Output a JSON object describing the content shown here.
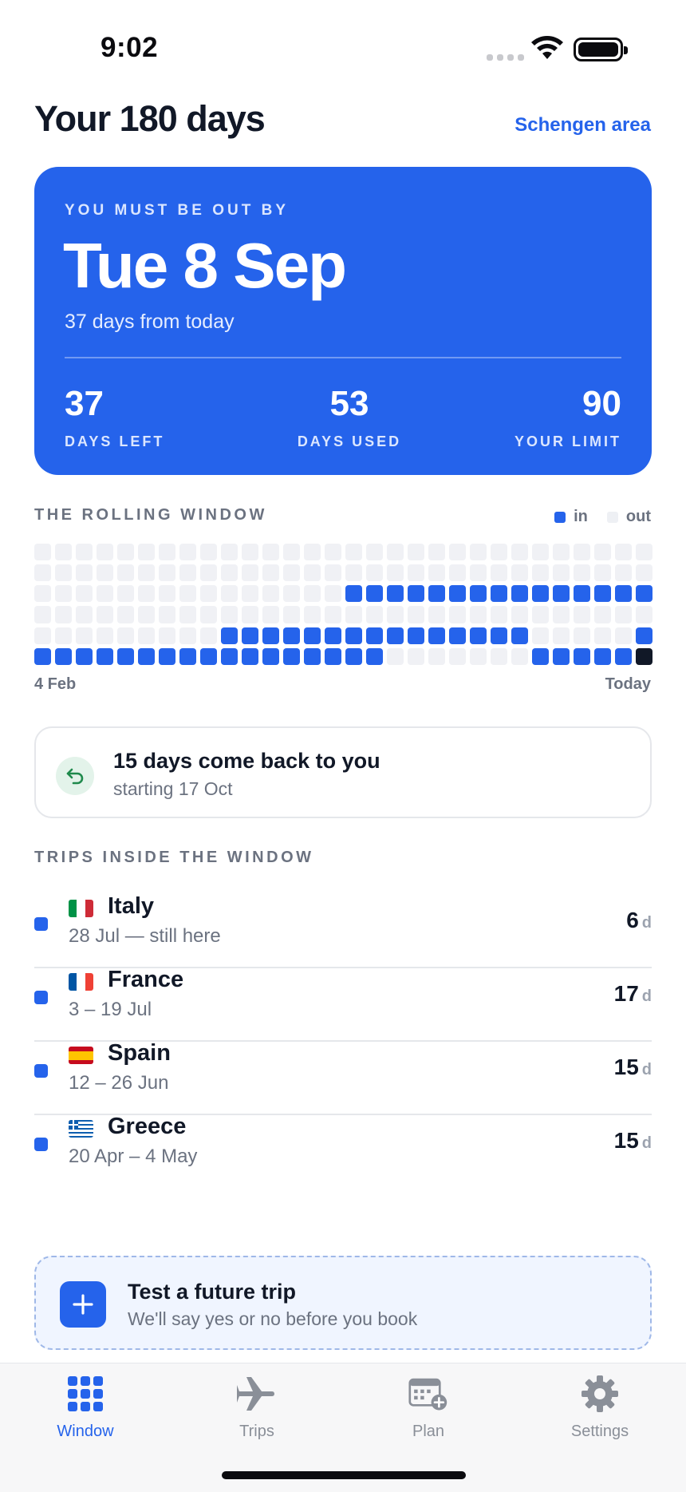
{
  "status_bar": {
    "time": "9:02"
  },
  "header": {
    "title": "Your 180 days",
    "area_link": "Schengen area"
  },
  "hero": {
    "eyebrow": "YOU MUST BE OUT BY",
    "date": "Tue 8 Sep",
    "subtitle": "37 days from today",
    "stats": [
      {
        "value": "37",
        "label": "DAYS LEFT"
      },
      {
        "value": "53",
        "label": "DAYS USED"
      },
      {
        "value": "90",
        "label": "YOUR LIMIT"
      }
    ],
    "color": "#2563eb"
  },
  "rolling_window": {
    "label": "THE ROLLING WINDOW",
    "legend_in": "in",
    "legend_out": "out",
    "start_label": "4 Feb",
    "end_label": "Today",
    "columns": 30,
    "rows": [
      "000000000000000000000000000000",
      "000000000000000000000000000000",
      "000000000000000111111111111111",
      "000000000000000000000000000000",
      "000000000111111111111111000001",
      "111111111111111110000000111112"
    ],
    "colors": {
      "in": "#2563eb",
      "out": "#f0f1f5",
      "today": "#111827"
    }
  },
  "return_card": {
    "icon": "return-arrow-icon",
    "title": "15 days come back to you",
    "subtitle": "starting 17 Oct"
  },
  "trips": {
    "label": "TRIPS INSIDE THE WINDOW",
    "unit": "d",
    "items": [
      {
        "country": "Italy",
        "flag": [
          "#009246",
          "#ffffff",
          "#ce2b37"
        ],
        "flag_dir": "v",
        "range": "28 Jul — still here",
        "days": "6"
      },
      {
        "country": "France",
        "flag": [
          "#0055a4",
          "#ffffff",
          "#ef4135"
        ],
        "flag_dir": "v",
        "range": "3 – 19 Jul",
        "days": "17"
      },
      {
        "country": "Spain",
        "flag": [
          "#c60b1e",
          "#ffc400",
          "#c60b1e"
        ],
        "flag_dir": "h",
        "range": "12 – 26 Jun",
        "days": "15"
      },
      {
        "country": "Greece",
        "flag": [
          "#0d5eaf",
          "#ffffff"
        ],
        "flag_dir": "stripes",
        "range": "20 Apr – 4 May",
        "days": "15"
      }
    ]
  },
  "future_trip": {
    "title": "Test a future trip",
    "subtitle": "We'll say yes or no before you book"
  },
  "tabbar": {
    "tabs": [
      {
        "label": "Window",
        "icon": "grid-icon",
        "active": true
      },
      {
        "label": "Trips",
        "icon": "airplane-icon",
        "active": false
      },
      {
        "label": "Plan",
        "icon": "calendar-add-icon",
        "active": false
      },
      {
        "label": "Settings",
        "icon": "gear-icon",
        "active": false
      }
    ]
  }
}
